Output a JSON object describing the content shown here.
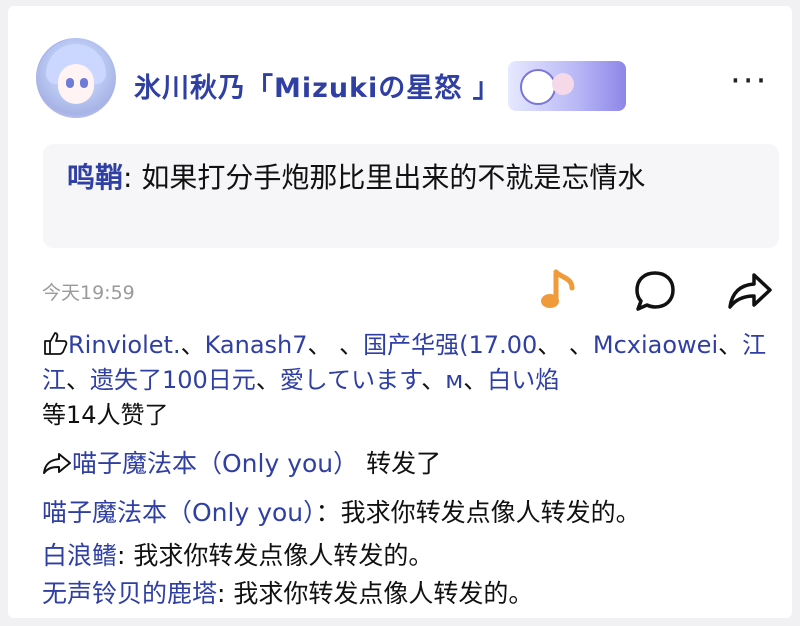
{
  "post": {
    "username": "氷川秋乃「Mizukiの星怒 」",
    "more_label": "···"
  },
  "quote": {
    "author": "鸣鞘",
    "separator": ": ",
    "text": "如果打分手炮那比里出来的不就是忘情水"
  },
  "meta": {
    "time": "今天19:59",
    "icons": [
      "music-note-icon",
      "comment-icon",
      "share-icon"
    ],
    "music_color": "#f09a3a"
  },
  "likes": {
    "names_line": "Rinviolet.、Kanash7、 、国产华强(17.00、    、Mcxiaowei、江江、遗失了100日元、愛しています、ᴍ、白い焰",
    "part1": "Rinviolet.",
    "sep1": "、",
    "part2": "Kanash7",
    "sep2": "、 、",
    "part3": "国产华强",
    "part4": "(17.00",
    "sep3": "、    、",
    "part5": "Mcxiaowei",
    "sep4": "、",
    "part6": "江江",
    "sep5": "、",
    "part7": "遗失了",
    "part8": "100日元",
    "sep6": "、",
    "part9": "愛しています",
    "sep7": "、",
    "part10": "ᴍ",
    "sep8": "、",
    "part11": "白い焰",
    "summary": "等14人赞了"
  },
  "repost": {
    "user": "喵子魔法本（Only you）",
    "action": "转发了"
  },
  "comments": [
    {
      "user": "喵子魔法本（Only you）",
      "sep": "：",
      "text": "我求你转发点像人转发的。"
    },
    {
      "user": "白浪鳍",
      "sep": ": ",
      "text": "我求你转发点像人转发的。"
    },
    {
      "user": "无声铃贝的鹿塔",
      "sep": ": ",
      "text": "我求你转发点像人转发的。"
    }
  ],
  "colors": {
    "accent": "#2f3fa3",
    "muted": "#9a9a9a",
    "bg": "#f1f1f3"
  }
}
